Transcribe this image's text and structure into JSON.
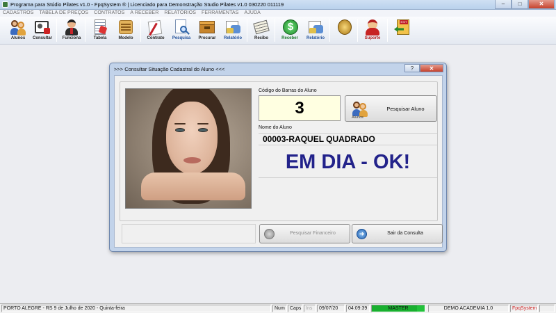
{
  "window": {
    "title": "Programa para Stúdio Pilates v1.0 - FpqSystem ® | Licenciado para  Demonstração Studio Pilates v1.0 030220 011119",
    "controls": {
      "minimize": "–",
      "maximize": "□",
      "close": "✕"
    }
  },
  "menu": [
    "CADASTROS",
    "TABELA DE PREÇOS",
    "CONTRATOS",
    "A RECEBER",
    "RELATÓRIOS",
    "FERRAMENTAS",
    "AJUDA"
  ],
  "toolbar": {
    "alunos": "Alunos",
    "consultar": "Consultar",
    "funciona": "Funciona",
    "tabela": "Tabela",
    "modelo": "Modelo",
    "contrato": "Contrato",
    "pesquisa": "Pesquisa",
    "procurar": "Procurar",
    "relatorio1": "Relatório",
    "recibo": "Recibo",
    "receber": "Receber",
    "relatorio2": "Relatório",
    "suporte": "Suporte"
  },
  "icons": {
    "alunos": "people-icon",
    "consultar": "id-card-icon",
    "funciona": "employee-icon",
    "tabela": "price-table-icon",
    "modelo": "scroll-icon",
    "contrato": "contract-icon",
    "pesquisa": "search-document-icon",
    "procurar": "box-icon",
    "relatorio1": "report-icon",
    "recibo": "receipt-icon",
    "receber": "dollar-icon",
    "relatorio2": "report-icon",
    "coins": "coin-icon",
    "suporte": "support-icon",
    "sair": "exit-icon"
  },
  "dialog": {
    "title": ">>>  Consultar Situação Cadastral do Aluno  <<<",
    "help": "?",
    "close": "✕",
    "barcode_label": "Código do Barras do Aluno",
    "barcode_value": "3",
    "search_button": "Pesquisar Aluno",
    "search_button_sub": "Alunos",
    "name_label": "Nome do Aluno",
    "name_value": "00003-RAQUEL QUADRADO",
    "status_value": "EM DIA - OK!",
    "finance_button": "Pesquisar  Financeiro",
    "exit_button": "Sair da Consulta",
    "status_color": "#22228a"
  },
  "statusbar": {
    "location": "PORTO ALEGRE - RS   9 de Julho de 2020 - Quinta-feira",
    "num": "Num",
    "caps": "Caps",
    "ins": "Ins",
    "date": "09/07/20",
    "time": "04:09:39",
    "user": "MASTER",
    "company": "DEMO ACADEMIA 1.0",
    "brand": "FpqSystem",
    "progress": 0.85
  },
  "colors": {
    "accent_green": "#22c23a",
    "close_red": "#c6422d",
    "dialog_frame": "#c2d3ea"
  }
}
